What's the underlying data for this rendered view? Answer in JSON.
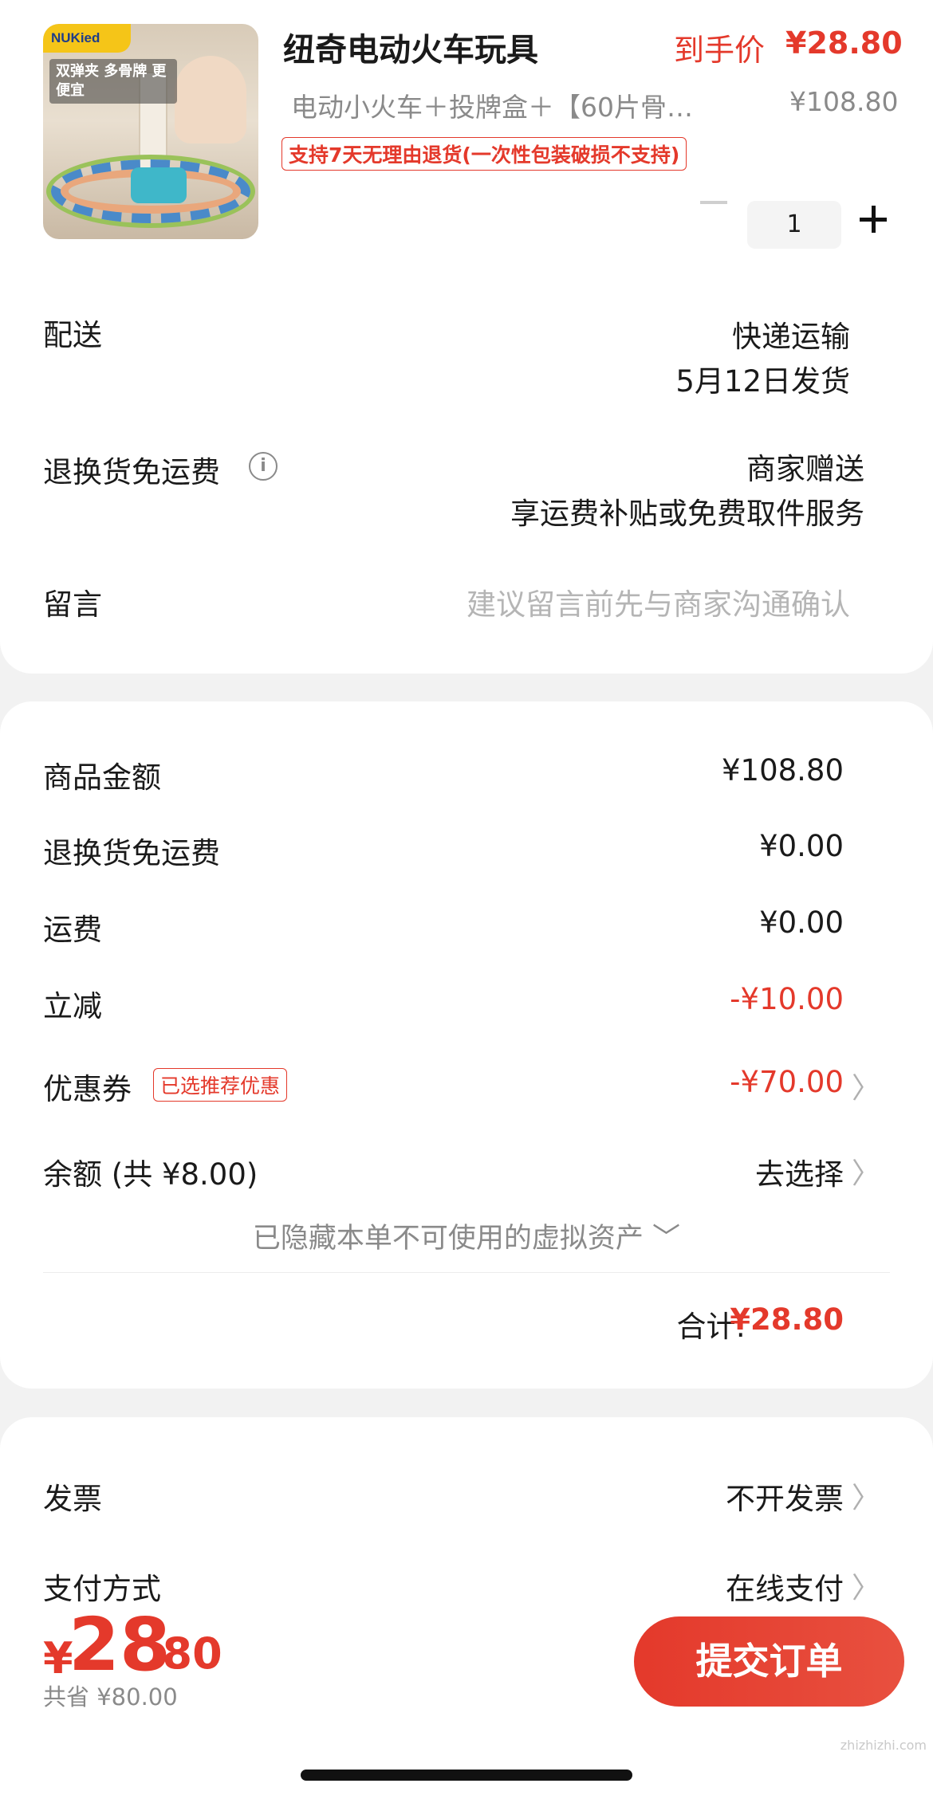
{
  "product": {
    "image_brand": "NUKied",
    "image_promo": "双弹夹 多骨牌 更便宜",
    "title": "纽奇电动火车玩具",
    "final_price_label": "到手价",
    "final_price": "¥28.80",
    "variant": "电动小火车＋投牌盒＋【60片骨…",
    "original_price": "¥108.80",
    "return_tag": "支持7天无理由退货(一次性包装破损不支持)",
    "quantity": "1"
  },
  "delivery": {
    "label": "配送",
    "method": "快递运输",
    "ship_date": "5月12日发货"
  },
  "return_shipping": {
    "label": "退换货免运费",
    "info_icon": "i",
    "value_line1": "商家赠送",
    "value_line2": "享运费补贴或免费取件服务"
  },
  "message": {
    "label": "留言",
    "placeholder": "建议留言前先与商家沟通确认"
  },
  "summary": {
    "goods_label": "商品金额",
    "goods_value": "¥108.80",
    "return_fee_label": "退换货免运费",
    "return_fee_value": "¥0.00",
    "shipping_label": "运费",
    "shipping_value": "¥0.00",
    "discount_label": "立减",
    "discount_value": "-¥10.00",
    "coupon_label": "优惠券",
    "coupon_tag": "已选推荐优惠",
    "coupon_value": "-¥70.00",
    "balance_label": "余额 (共 ¥8.00)",
    "balance_value": "去选择",
    "hidden_assets": "已隐藏本单不可使用的虚拟资产 ﹀",
    "total_label": "合计:",
    "total_value": "¥28.80"
  },
  "invoice": {
    "label": "发票",
    "value": "不开发票"
  },
  "payment": {
    "label": "支付方式",
    "value": "在线支付"
  },
  "bottom": {
    "currency": "¥",
    "amount_int": "28",
    "amount_dec": ".80",
    "savings": "共省 ¥80.00",
    "submit": "提交订单"
  },
  "watermark": "zhizhizhi.com",
  "chevron": "〉"
}
